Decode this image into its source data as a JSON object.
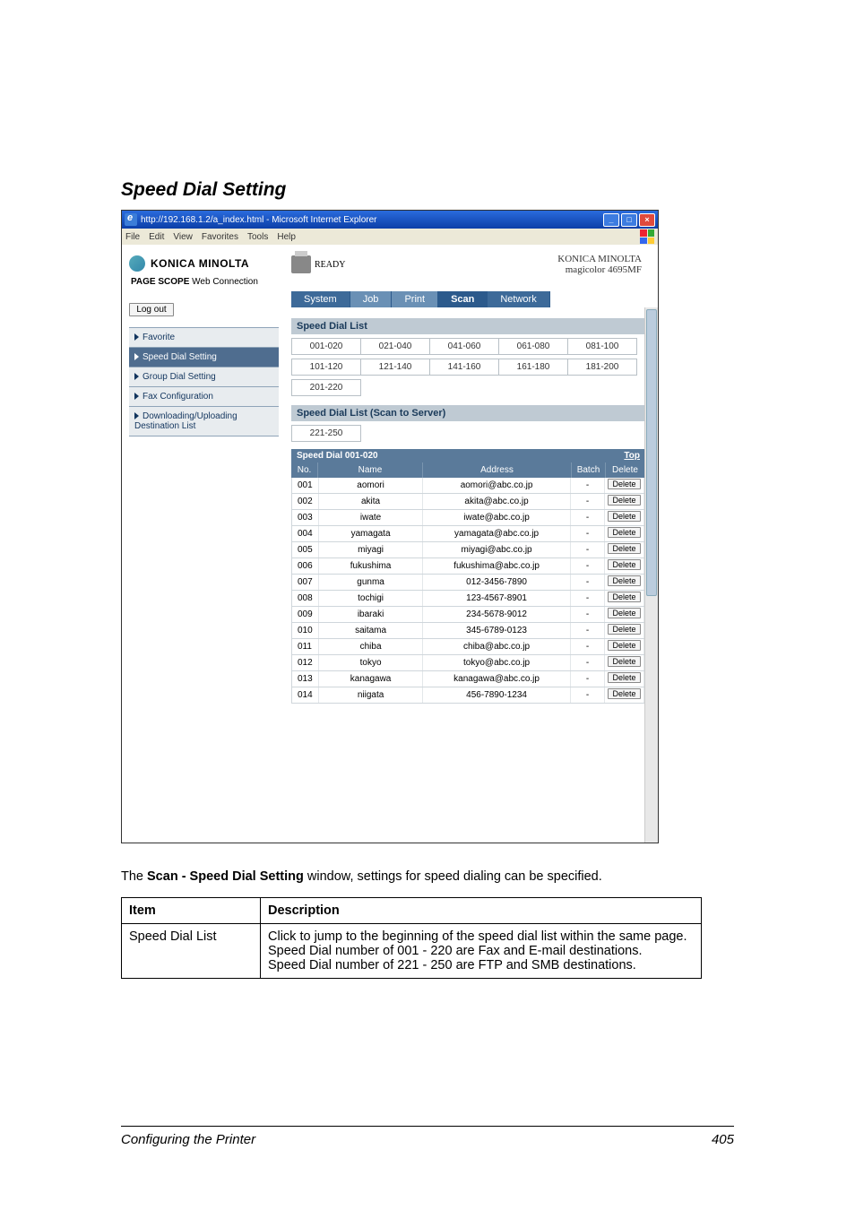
{
  "heading": "Speed Dial Setting",
  "browser": {
    "title": "http://192.168.1.2/a_index.html - Microsoft Internet Explorer",
    "menus": [
      "File",
      "Edit",
      "View",
      "Favorites",
      "Tools",
      "Help"
    ],
    "min": "_",
    "max": "□",
    "close": "×"
  },
  "brand": {
    "name": "KONICA MINOLTA",
    "sub_prefix": "PAGE SCOPE",
    "sub": "Web Connection",
    "logout": "Log out",
    "ready": "READY",
    "km": "KONICA MINOLTA",
    "model": "magicolor 4695MF"
  },
  "tabs": {
    "system": "System",
    "job": "Job",
    "print": "Print",
    "scan": "Scan",
    "network": "Network"
  },
  "sidebar": {
    "items": [
      "Favorite",
      "Speed Dial Setting",
      "Group Dial Setting",
      "Fax Configuration",
      "Downloading/Uploading Destination List"
    ]
  },
  "sdl": {
    "title": "Speed Dial List",
    "ranges_row1": [
      "001-020",
      "021-040",
      "041-060",
      "061-080",
      "081-100"
    ],
    "ranges_row2": [
      "101-120",
      "121-140",
      "141-160",
      "161-180",
      "181-200"
    ],
    "ranges_row3": [
      "201-220"
    ],
    "scan_server_title": "Speed Dial List (Scan to Server)",
    "server_ranges": [
      "221-250"
    ],
    "list_title": "Speed Dial 001-020",
    "top": "Top",
    "headers": {
      "no": "No.",
      "name": "Name",
      "address": "Address",
      "batch": "Batch",
      "delete": "Delete"
    },
    "delete_btn": "Delete",
    "rows": [
      {
        "no": "001",
        "name": "aomori",
        "addr": "aomori@abc.co.jp",
        "batch": "-"
      },
      {
        "no": "002",
        "name": "akita",
        "addr": "akita@abc.co.jp",
        "batch": "-"
      },
      {
        "no": "003",
        "name": "iwate",
        "addr": "iwate@abc.co.jp",
        "batch": "-"
      },
      {
        "no": "004",
        "name": "yamagata",
        "addr": "yamagata@abc.co.jp",
        "batch": "-"
      },
      {
        "no": "005",
        "name": "miyagi",
        "addr": "miyagi@abc.co.jp",
        "batch": "-"
      },
      {
        "no": "006",
        "name": "fukushima",
        "addr": "fukushima@abc.co.jp",
        "batch": "-"
      },
      {
        "no": "007",
        "name": "gunma",
        "addr": "012-3456-7890",
        "batch": "-"
      },
      {
        "no": "008",
        "name": "tochigi",
        "addr": "123-4567-8901",
        "batch": "-"
      },
      {
        "no": "009",
        "name": "ibaraki",
        "addr": "234-5678-9012",
        "batch": "-"
      },
      {
        "no": "010",
        "name": "saitama",
        "addr": "345-6789-0123",
        "batch": "-"
      },
      {
        "no": "011",
        "name": "chiba",
        "addr": "chiba@abc.co.jp",
        "batch": "-"
      },
      {
        "no": "012",
        "name": "tokyo",
        "addr": "tokyo@abc.co.jp",
        "batch": "-"
      },
      {
        "no": "013",
        "name": "kanagawa",
        "addr": "kanagawa@abc.co.jp",
        "batch": "-"
      },
      {
        "no": "014",
        "name": "niigata",
        "addr": "456-7890-1234",
        "batch": "-"
      }
    ]
  },
  "below": {
    "prefix": "The ",
    "bold": "Scan - Speed Dial Setting",
    "suffix": " window, settings for speed dialing can be specified."
  },
  "table": {
    "h1": "Item",
    "h2": "Description",
    "r1c1": "Speed Dial List",
    "r1c2": "Click to jump to the beginning of the speed dial list within the same page.\nSpeed Dial number of 001 - 220 are Fax and E-mail destinations.\nSpeed Dial number of 221 - 250 are FTP and SMB destinations."
  },
  "footer": {
    "left": "Configuring the Printer",
    "right": "405"
  }
}
